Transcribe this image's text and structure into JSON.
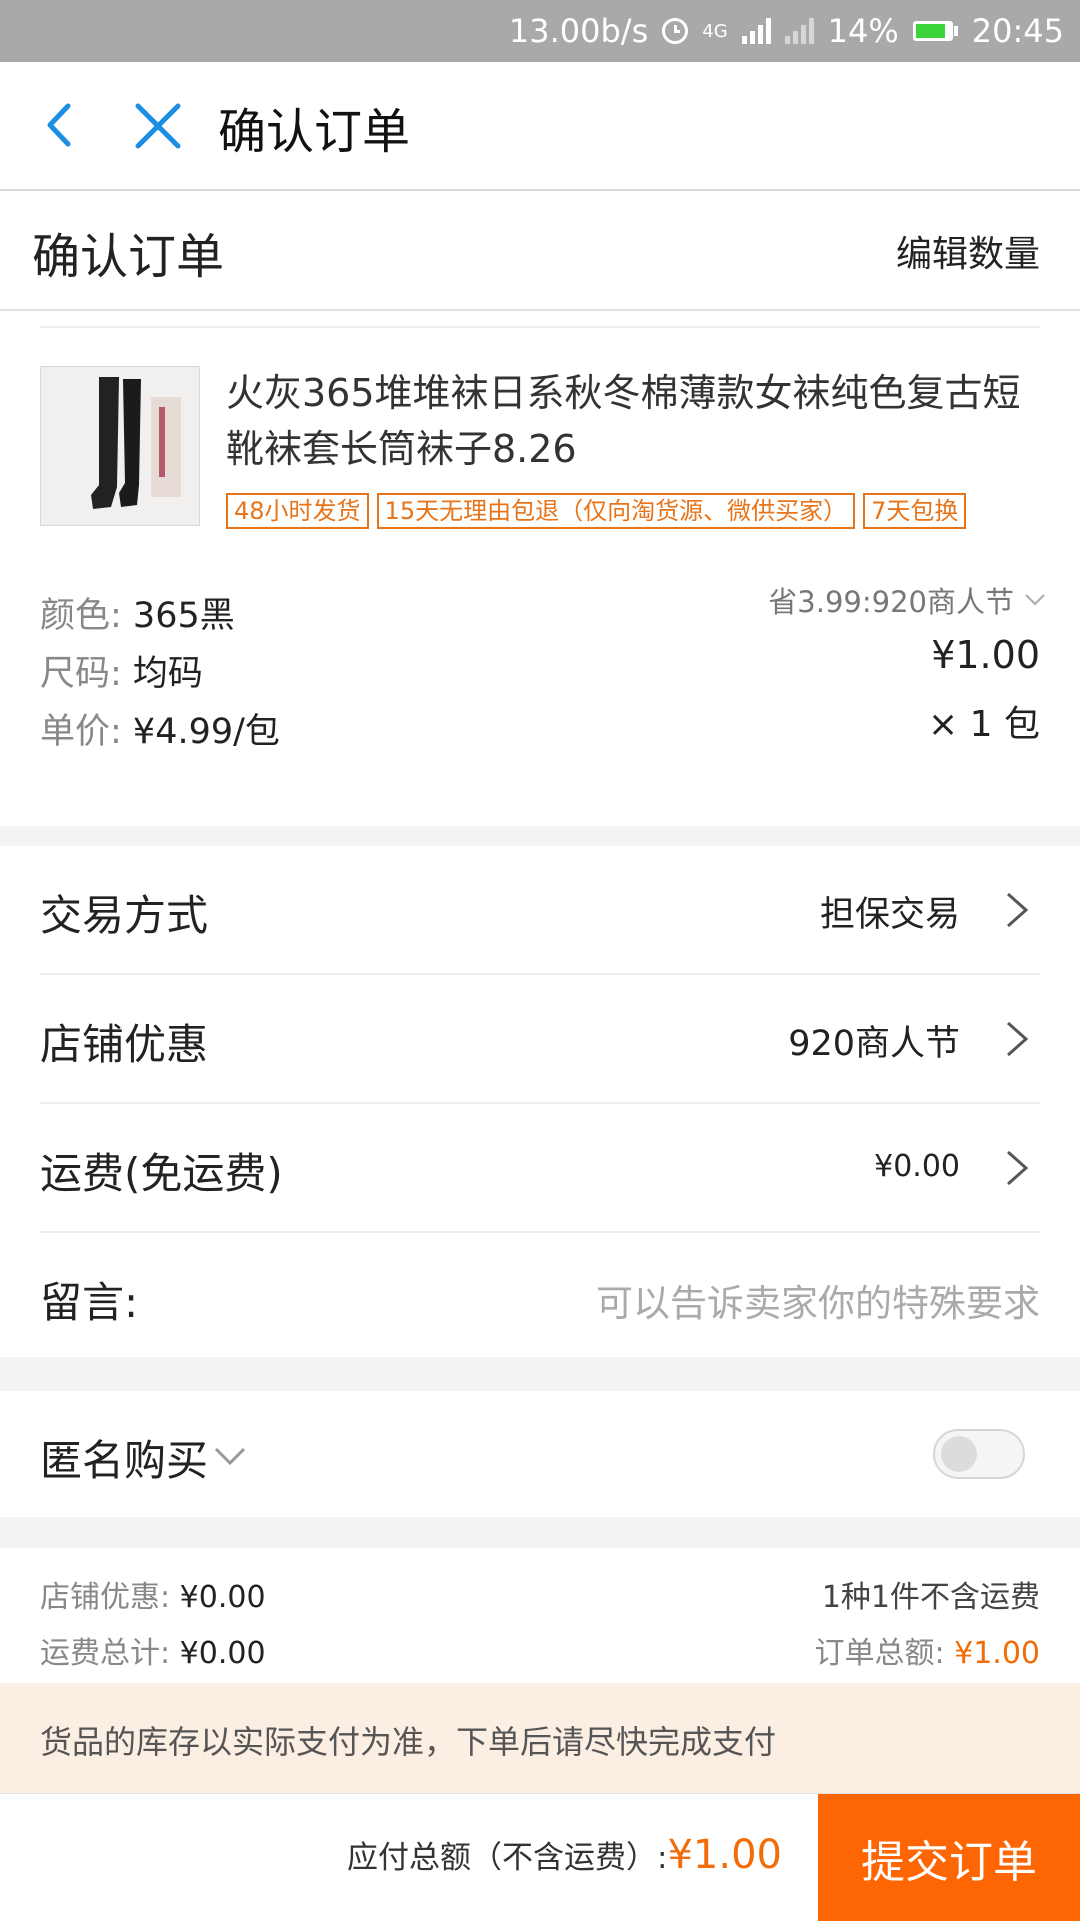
{
  "status_bar": {
    "net_speed": "13.00b/s",
    "network": "4G",
    "battery": "14%",
    "time": "20:45",
    "battery_level": 0.14
  },
  "nav": {
    "title": "确认订单"
  },
  "header": {
    "title": "确认订单",
    "edit_label": "编辑数量"
  },
  "product": {
    "title": "火灰365堆堆袜日系秋冬棉薄款女袜纯色复古短靴袜套长筒袜子8.26",
    "tags": [
      "48小时发货",
      "15天无理由包退（仅向淘货源、微供买家）",
      "7天包换"
    ],
    "attrs": [
      {
        "key": "颜色: ",
        "value": "365黑"
      },
      {
        "key": "尺码: ",
        "value": "均码"
      },
      {
        "key": "单价: ",
        "value": "¥4.99/包"
      }
    ],
    "promo": "省3.99:920商人节",
    "price": "¥1.00",
    "qty": "× 1 包"
  },
  "rows": {
    "trade": {
      "label": "交易方式",
      "value": "担保交易"
    },
    "shop_discount": {
      "label": "店铺优惠",
      "value": "920商人节"
    },
    "shipping": {
      "label": "运费(免运费)",
      "value": "¥0.00"
    },
    "message": {
      "label": "留言:",
      "placeholder": "可以告诉卖家你的特殊要求"
    }
  },
  "anonymous": {
    "label": "匿名购买",
    "enabled": false
  },
  "summary": {
    "shop_discount_label": "店铺优惠: ",
    "shop_discount_value": "¥0.00",
    "shipping_total_label": "运费总计: ",
    "shipping_total_value": "¥0.00",
    "items_note": "1种1件不含运费",
    "order_total_label": "订单总额: ",
    "order_total_value": "¥1.00"
  },
  "notice": "货品的库存以实际支付为准，下单后请尽快完成支付",
  "footer": {
    "total_label": "应付总额（不含运费）:",
    "total_value": "¥1.00",
    "submit_label": "提交订单"
  },
  "colors": {
    "accent_orange": "#fe6603",
    "nav_icon_blue": "#1a8fe3",
    "notice_bg": "#fbeee2"
  }
}
